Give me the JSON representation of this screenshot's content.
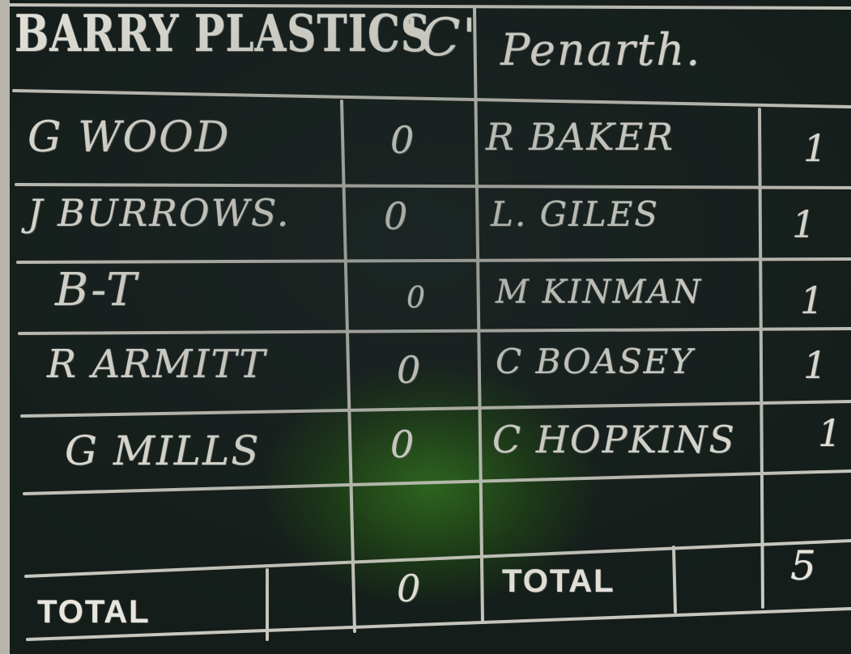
{
  "home": {
    "team": "BARRY PLASTICS",
    "team_suffix": "'C'",
    "players": [
      {
        "name": "G WOOD",
        "score": "0"
      },
      {
        "name": "J BURROWS.",
        "score": "0"
      },
      {
        "name": "B-T",
        "score": "0"
      },
      {
        "name": "R ARMITT",
        "score": "0"
      },
      {
        "name": "G MILLS",
        "score": "0"
      }
    ],
    "total_label": "TOTAL",
    "total_score": "0"
  },
  "away": {
    "team": "Penarth.",
    "players": [
      {
        "name": "R BAKER",
        "score": "1"
      },
      {
        "name": "L. GILES",
        "score": "1"
      },
      {
        "name": "M KINMAN",
        "score": "1"
      },
      {
        "name": "C BOASEY",
        "score": "1"
      },
      {
        "name": "C HOPKINS",
        "score": "1"
      }
    ],
    "total_label": "TOTAL",
    "total_score": "5"
  }
}
